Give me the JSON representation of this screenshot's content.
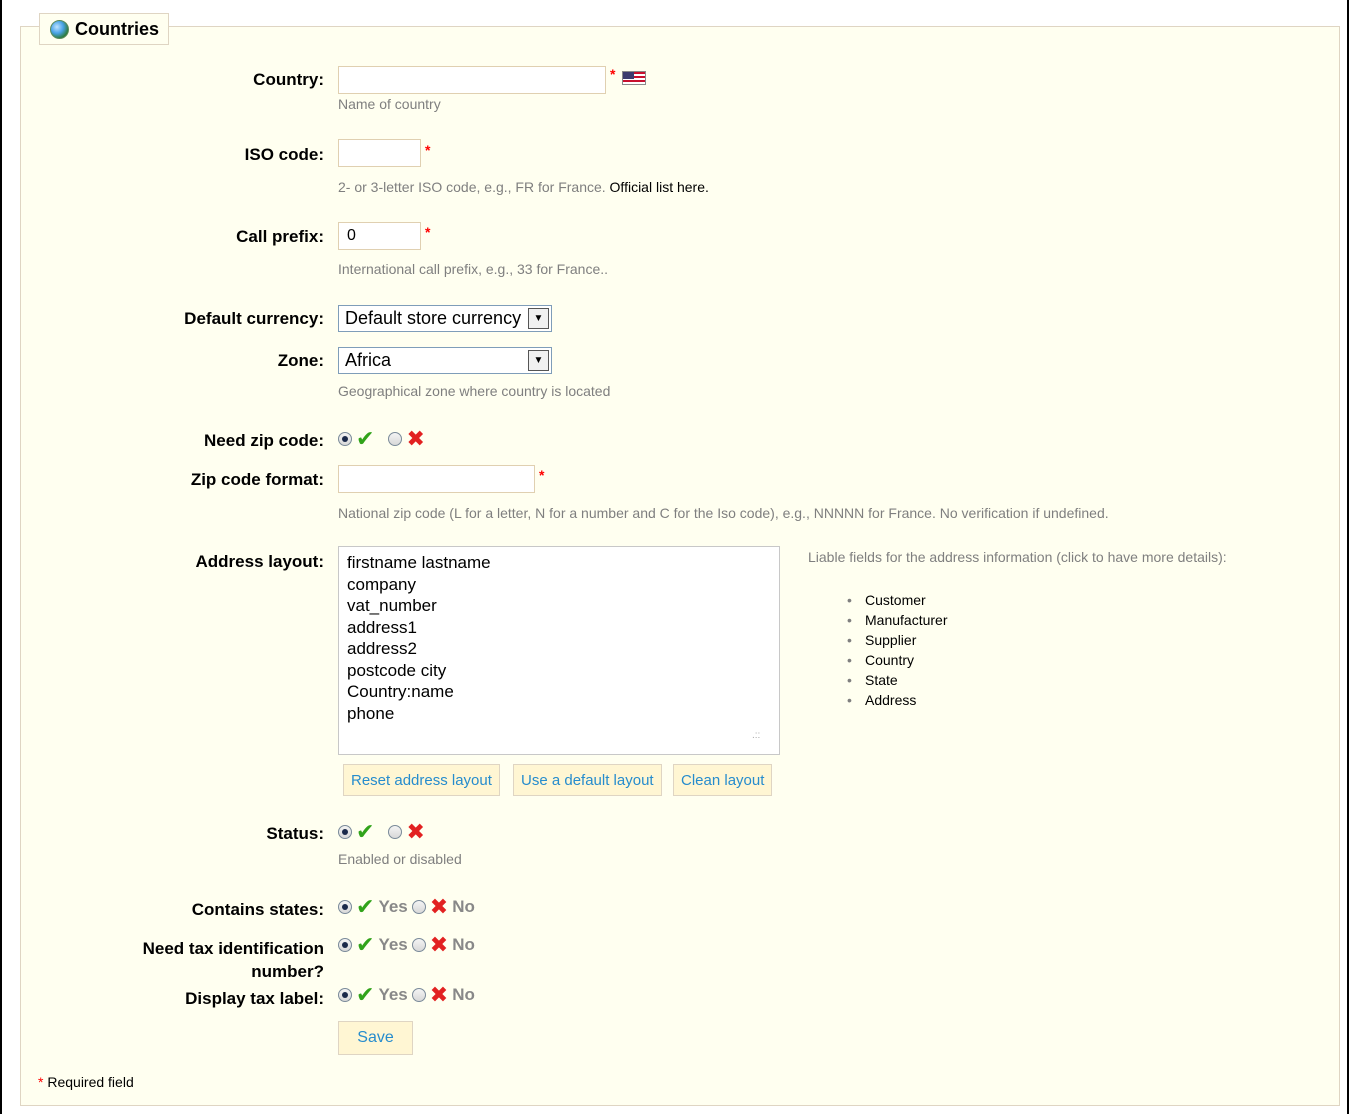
{
  "header": {
    "title": "Countries",
    "icon": "globe-icon"
  },
  "country": {
    "label": "Country:",
    "value": "",
    "hint": "Name of country",
    "required": "*"
  },
  "iso": {
    "label": "ISO code:",
    "value": "",
    "hint": "2- or 3-letter ISO code, e.g., FR for France.",
    "link": "Official list here.",
    "required": "*"
  },
  "call_prefix": {
    "label": "Call prefix:",
    "value": "0",
    "hint": "International call prefix, e.g., 33 for France..",
    "required": "*"
  },
  "default_currency": {
    "label": "Default currency:",
    "value": "Default store currency"
  },
  "zone": {
    "label": "Zone:",
    "value": "Africa",
    "hint": "Geographical zone where country is located"
  },
  "need_zip": {
    "label": "Need zip code:",
    "selected": "yes"
  },
  "zip_format": {
    "label": "Zip code format:",
    "value": "",
    "hint": "National zip code (L for a letter, N for a number and C for the Iso code), e.g., NNNNN for France. No verification if undefined.",
    "required": "*"
  },
  "address_layout": {
    "label": "Address layout:",
    "lines": [
      "firstname lastname",
      "company",
      "vat_number",
      "address1",
      "address2",
      "postcode city",
      "Country:name",
      "phone"
    ],
    "liable_title": "Liable fields for the address information (click to have more details):",
    "liable_items": [
      "Customer",
      "Manufacturer",
      "Supplier",
      "Country",
      "State",
      "Address"
    ],
    "buttons": {
      "reset": "Reset address layout",
      "default": "Use a default layout",
      "clean": "Clean layout"
    }
  },
  "status": {
    "label": "Status:",
    "hint": "Enabled or disabled",
    "selected": "yes"
  },
  "contains_states": {
    "label": "Contains states:",
    "yes": "Yes",
    "no": "No",
    "selected": "yes"
  },
  "need_tax_id": {
    "label": "Need tax identification number?",
    "yes": "Yes",
    "no": "No",
    "selected": "yes"
  },
  "display_tax_label": {
    "label": "Display tax label:",
    "yes": "Yes",
    "no": "No",
    "selected": "yes"
  },
  "save_label": "Save",
  "footer": {
    "star": "*",
    "text": "Required field"
  },
  "colors": {
    "panel_bg": "#fffff0",
    "border": "#dfd5c3",
    "button_bg": "#fff6d3",
    "button_text": "#268ccd",
    "required": "#ff0000",
    "yes": "#31a31a",
    "no": "#e22121"
  }
}
